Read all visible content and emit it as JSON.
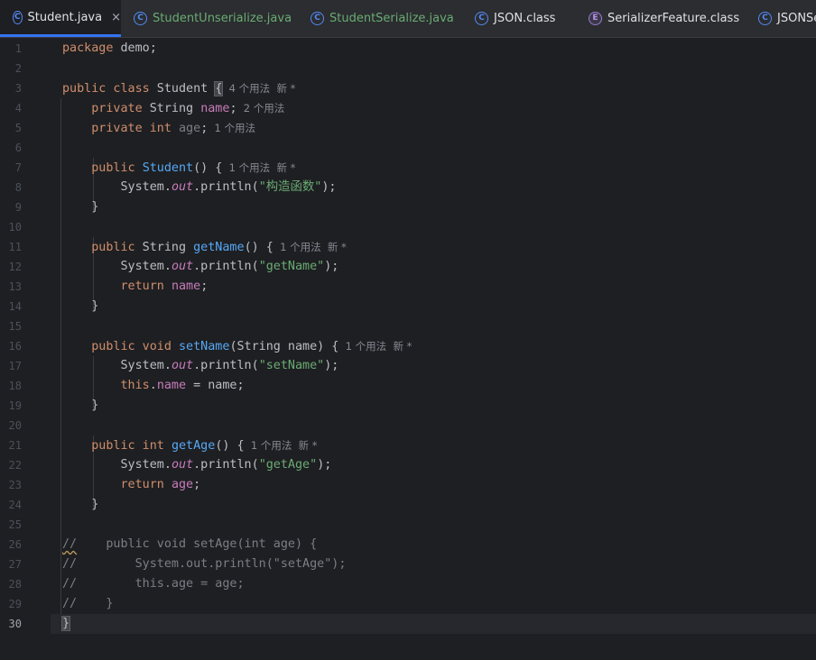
{
  "tabs": [
    {
      "label": "Student.java",
      "icon": "class-icon",
      "color": "#dfe1e5",
      "active": true
    },
    {
      "label": "StudentUnserialize.java",
      "icon": "class-icon",
      "color": "#6aab73"
    },
    {
      "label": "StudentSerialize.java",
      "icon": "class-icon",
      "color": "#6aab73"
    },
    {
      "label": "JSON.class",
      "icon": "class-icon",
      "color": "#dfe1e5"
    },
    {
      "label": "SerializerFeature.class",
      "icon": "enum-icon",
      "color": "#dfe1e5"
    },
    {
      "label": "JSONSe",
      "icon": "class-icon",
      "color": "#dfe1e5"
    }
  ],
  "tab_close_glyph": "×",
  "icon_glyphs": {
    "class": "C",
    "enum": "E"
  },
  "current_line": 30,
  "lines": [
    [
      [
        "kw",
        "package"
      ],
      [
        "p",
        " demo;"
      ]
    ],
    [],
    [
      [
        "kw",
        "public class"
      ],
      [
        "p",
        " Student "
      ],
      [
        "bh",
        "{"
      ],
      [
        "hint",
        "  4 个用法  新 *"
      ]
    ],
    [
      [
        "p",
        "    "
      ],
      [
        "kw",
        "private"
      ],
      [
        "p",
        " String "
      ],
      [
        "fld",
        "name"
      ],
      [
        "p",
        ";"
      ],
      [
        "hint",
        "  2 个用法"
      ]
    ],
    [
      [
        "p",
        "    "
      ],
      [
        "kw",
        "private int"
      ],
      [
        "p",
        " "
      ],
      [
        "cmv",
        "age"
      ],
      [
        "p",
        ";"
      ],
      [
        "hint",
        "  1 个用法"
      ]
    ],
    [],
    [
      [
        "p",
        "    "
      ],
      [
        "kw",
        "public"
      ],
      [
        "p",
        " "
      ],
      [
        "fn",
        "Student"
      ],
      [
        "p",
        "() {"
      ],
      [
        "hint",
        "  1 个用法  新 *"
      ]
    ],
    [
      [
        "p",
        "        System."
      ],
      [
        "it",
        "out"
      ],
      [
        "p",
        ".println("
      ],
      [
        "st",
        "\"构造函数\""
      ],
      [
        "p",
        ");"
      ]
    ],
    [
      [
        "p",
        "    }"
      ]
    ],
    [],
    [
      [
        "p",
        "    "
      ],
      [
        "kw",
        "public"
      ],
      [
        "p",
        " String "
      ],
      [
        "fn",
        "getName"
      ],
      [
        "p",
        "() {"
      ],
      [
        "hint",
        "  1 个用法  新 *"
      ]
    ],
    [
      [
        "p",
        "        System."
      ],
      [
        "it",
        "out"
      ],
      [
        "p",
        ".println("
      ],
      [
        "st",
        "\"getName\""
      ],
      [
        "p",
        ");"
      ]
    ],
    [
      [
        "p",
        "        "
      ],
      [
        "kw",
        "return"
      ],
      [
        "p",
        " "
      ],
      [
        "fld",
        "name"
      ],
      [
        "p",
        ";"
      ]
    ],
    [
      [
        "p",
        "    }"
      ]
    ],
    [],
    [
      [
        "p",
        "    "
      ],
      [
        "kw",
        "public void"
      ],
      [
        "p",
        " "
      ],
      [
        "fn",
        "setName"
      ],
      [
        "p",
        "(String name) {"
      ],
      [
        "hint",
        "  1 个用法  新 *"
      ]
    ],
    [
      [
        "p",
        "        System."
      ],
      [
        "it",
        "out"
      ],
      [
        "p",
        ".println("
      ],
      [
        "st",
        "\"setName\""
      ],
      [
        "p",
        ");"
      ]
    ],
    [
      [
        "p",
        "        "
      ],
      [
        "kw",
        "this"
      ],
      [
        "p",
        "."
      ],
      [
        "fld",
        "name"
      ],
      [
        "p",
        " = name;"
      ]
    ],
    [
      [
        "p",
        "    }"
      ]
    ],
    [],
    [
      [
        "p",
        "    "
      ],
      [
        "kw",
        "public int"
      ],
      [
        "p",
        " "
      ],
      [
        "fn",
        "getAge"
      ],
      [
        "p",
        "() {"
      ],
      [
        "hint",
        "  1 个用法  新 *"
      ]
    ],
    [
      [
        "p",
        "        System."
      ],
      [
        "it",
        "out"
      ],
      [
        "p",
        ".println("
      ],
      [
        "st",
        "\"getAge\""
      ],
      [
        "p",
        ");"
      ]
    ],
    [
      [
        "p",
        "        "
      ],
      [
        "kw",
        "return"
      ],
      [
        "p",
        " "
      ],
      [
        "fld",
        "age"
      ],
      [
        "p",
        ";"
      ]
    ],
    [
      [
        "p",
        "    }"
      ]
    ],
    [],
    [
      [
        "cmsq",
        "//"
      ],
      [
        "cm",
        "    public void setAge(int age) {"
      ]
    ],
    [
      [
        "cm",
        "//        System.out.println(\"setAge\");"
      ]
    ],
    [
      [
        "cm",
        "//        this.age = age;"
      ]
    ],
    [
      [
        "cm",
        "//    }"
      ]
    ],
    [
      [
        "bh",
        "}"
      ]
    ]
  ]
}
